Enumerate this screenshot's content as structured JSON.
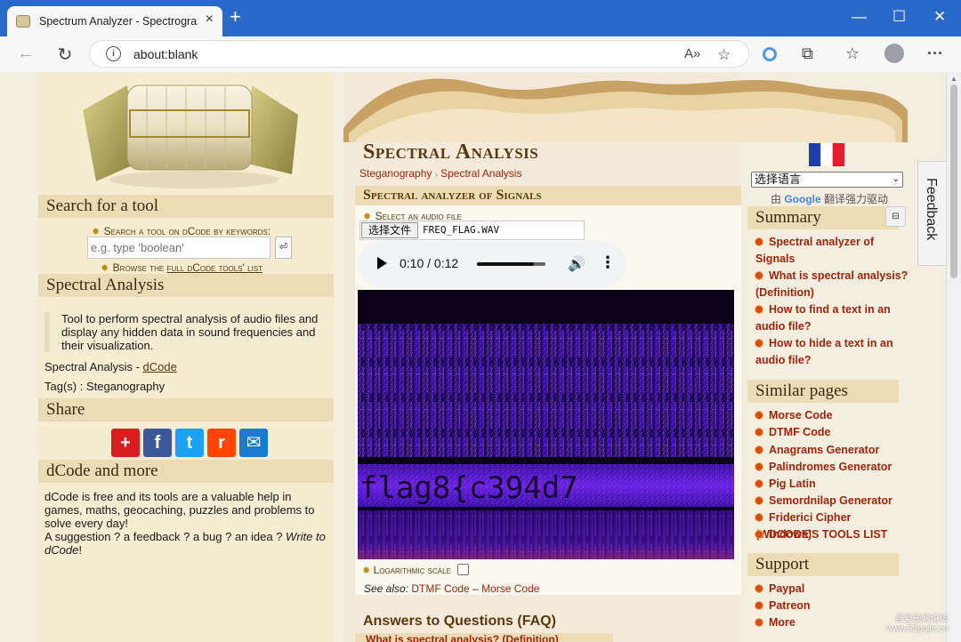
{
  "browser": {
    "tab_title": "Spectrum Analyzer - Spectrogram",
    "tab_close": "×",
    "new_tab": "+",
    "minimize": "—",
    "maximize": "☐",
    "close": "✕",
    "back": "←",
    "reload": "↻",
    "url": "about:blank",
    "read_aloud": "A»",
    "add_favorite": "☆",
    "extensions": "⧉",
    "favorites": "☆",
    "more": "···"
  },
  "left": {
    "search_header": "Search for a tool",
    "search_label": "Search a tool on dCode by keywords:",
    "search_placeholder": "e.g. type 'boolean'",
    "search_btn": "⏎",
    "browse_prefix": "Browse the ",
    "browse_link": "full dCode tools' list",
    "tool_header": "Spectral Analysis",
    "tool_desc": "Tool to perform spectral analysis of audio files and display any hidden data in sound frequencies and their visualization.",
    "tool_by_prefix": "Spectral Analysis - ",
    "tool_by_link": "dCode",
    "tags": "Tag(s) : Steganography",
    "share_header": "Share",
    "share_buttons": [
      {
        "icon": "plus-icon",
        "glyph": "+",
        "color": "#d71f1f"
      },
      {
        "icon": "facebook-icon",
        "glyph": "f",
        "color": "#3b5998"
      },
      {
        "icon": "twitter-icon",
        "glyph": "t",
        "color": "#1da1f2"
      },
      {
        "icon": "reddit-icon",
        "glyph": "r",
        "color": "#ff4500"
      },
      {
        "icon": "email-icon",
        "glyph": "✉",
        "color": "#1a7ad0"
      }
    ],
    "more_header": "dCode and more",
    "more_text_1": "dCode is free and its tools are a valuable help in games, maths, geocaching, puzzles and problems to solve every day!",
    "more_text_2": "A suggestion ? a feedback ? a bug ? an idea ? ",
    "more_text_link": "Write to dCode",
    "more_text_end": "!"
  },
  "main": {
    "title": "Spectral Analysis",
    "crumb_1": "Steganography",
    "crumb_sep": "›",
    "crumb_2": "Spectral Analysis",
    "section_header": "Spectral analyzer of Signals",
    "select_label": "Select an audio file",
    "file_button": "选择文件",
    "file_name": "FREQ_FLAG.WAV",
    "audio_time": "0:10 / 0:12",
    "audio_progress": 0.83,
    "spectrogram_text": "flag8{c394d7",
    "log_label": "Logarithmic scale",
    "see_also_prefix": "See also: ",
    "see_also_1": "DTMF Code",
    "see_also_sep": " – ",
    "see_also_2": "Morse Code",
    "faq_title": "Answers to Questions (FAQ)",
    "faq_item": "What is spectral analysis? (Definition)"
  },
  "right": {
    "lang_select": "选择语言",
    "powered_prefix": "由 ",
    "powered_google": "Google",
    "powered_suffix": " 翻译强力驱动",
    "summary_header": "Summary",
    "collapse_btn": "⊟",
    "summary_items": [
      "Spectral analyzer of Signals",
      "What is spectral analysis? (Definition)",
      "How to find a text in an audio file?",
      "How to hide a text in an audio file?"
    ],
    "similar_header": "Similar pages",
    "similar_items": [
      "Morse Code",
      "DTMF Code",
      "Anagrams Generator",
      "Palindromes Generator",
      "Pig Latin",
      "Semordnilap Generator",
      "Friderici Cipher (Windows)",
      "DCODE'S TOOLS LIST"
    ],
    "support_header": "Support",
    "support_items": [
      "Paypal",
      "Patreon",
      "More"
    ],
    "feedback": "Feedback"
  },
  "watermark_1": "吾爱破解论坛",
  "watermark_2": "www.52pojie.cn"
}
